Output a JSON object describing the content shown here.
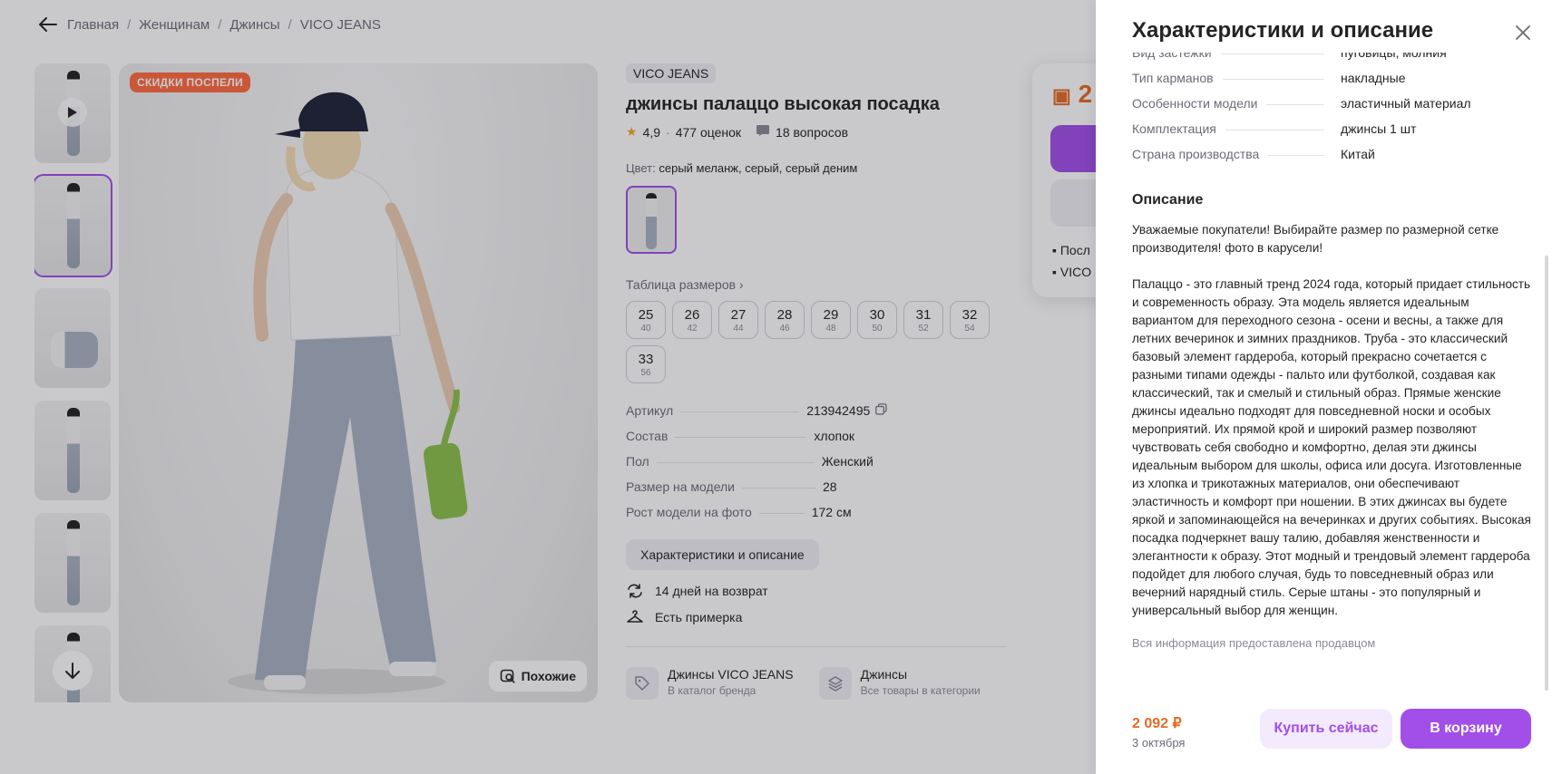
{
  "breadcrumbs": [
    "Главная",
    "Женщинам",
    "Джинсы",
    "VICO JEANS"
  ],
  "gallery": {
    "badge": "СКИДКИ ПОСПЕЛИ",
    "similar_label": "Похожие"
  },
  "product": {
    "brand": "VICO JEANS",
    "title": "джинсы палаццо высокая посадка",
    "rating": "4,9",
    "reviews": "477 оценок",
    "questions": "18 вопросов",
    "color_label": "Цвет:",
    "color_value": "серый меланж, серый, серый деним",
    "size_table_label": "Таблица размеров",
    "sizes": [
      {
        "n": "25",
        "ru": "40"
      },
      {
        "n": "26",
        "ru": "42"
      },
      {
        "n": "27",
        "ru": "44"
      },
      {
        "n": "28",
        "ru": "46"
      },
      {
        "n": "29",
        "ru": "48"
      },
      {
        "n": "30",
        "ru": "50"
      },
      {
        "n": "31",
        "ru": "52"
      },
      {
        "n": "32",
        "ru": "54"
      },
      {
        "n": "33",
        "ru": "56"
      }
    ],
    "specs": [
      {
        "k": "Артикул",
        "v": "213942495"
      },
      {
        "k": "Состав",
        "v": "хлопок"
      },
      {
        "k": "Пол",
        "v": "Женский"
      },
      {
        "k": "Размер на модели",
        "v": "28"
      },
      {
        "k": "Рост модели на фото",
        "v": "172 см"
      }
    ],
    "char_button": "Характеристики и описание",
    "return_text": "14 дней на возврат",
    "fitting_text": "Есть примерка",
    "cat_brand_title": "Джинсы VICO JEANS",
    "cat_brand_sub": "В каталог бренда",
    "cat_all_title": "Джинсы",
    "cat_all_sub": "Все товары в категории"
  },
  "buybox": {
    "price_partial": "2",
    "line1": "Посл",
    "line2": "VICO"
  },
  "panel": {
    "title": "Характеристики и описание",
    "rows": [
      {
        "k": "Вид застежки",
        "v": "пуговицы; молния"
      },
      {
        "k": "Тип карманов",
        "v": "накладные"
      },
      {
        "k": "Особенности модели",
        "v": "эластичный материал"
      },
      {
        "k": "Комплектация",
        "v": "джинсы 1 шт"
      },
      {
        "k": "Страна производства",
        "v": "Китай"
      }
    ],
    "desc_heading": "Описание",
    "desc_p1": "Уважаемые покупатели! Выбирайте размер по размерной сетке производителя! фото в карусели!",
    "desc_p2": "Палаццо - это главный тренд 2024 года, который придает стильность и современность образу. Эта модель является идеальным вариантом для переходного сезона - осени и весны, а также для летних вечеринок и зимних праздников. Труба - это классический базовый элемент гардероба, который прекрасно сочетается с разными типами одежды - пальто или футболкой, создавая как классический, так и смелый и стильный образ. Прямые женские джинсы идеально подходят для повседневной носки и особых мероприятий. Их прямой крой и широкий размер позволяют чувствовать себя свободно и комфортно, делая эти джинсы идеальным выбором для школы, офиса или досуга. Изготовленные из хлопка и трикотажных материалов, они обеспечивают эластичность и комфорт при ношении. В этих джинсах вы будете яркой и запоминающейся на вечеринках и других событиях. Высокая посадка подчеркнет вашу талию, добавляя женственности и элегантности к образу. Этот модный и трендовый элемент гардероба подойдет для любого случая, будь то повседневный образ или вечерний нарядный стиль. Серые штаны - это популярный и универсальный выбор для женщин.",
    "seller_note": "Вся информация предоставлена продавцом",
    "footer_price": "2 092 ₽",
    "footer_date": "3 октября",
    "buy_now": "Купить сейчас",
    "add_to_cart": "В корзину"
  },
  "colors": {
    "accent": "#a24ee8",
    "price": "#e56b24",
    "badge": "#ff6a3d"
  }
}
